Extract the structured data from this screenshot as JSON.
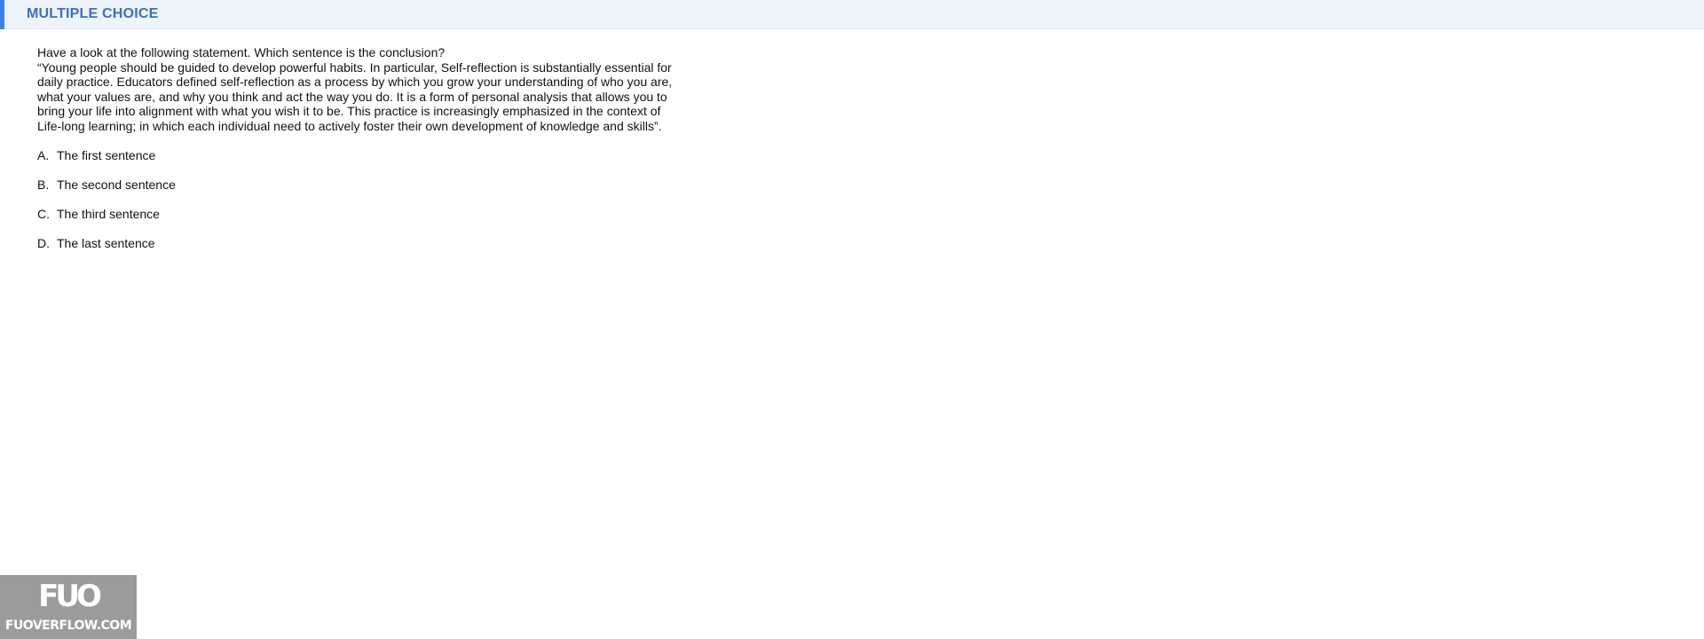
{
  "header": {
    "title": "MULTIPLE CHOICE",
    "accent_color": "#3b82e6",
    "background_color": "#eef4fc",
    "title_color": "#3a6fc4"
  },
  "question": {
    "prompt": "Have a look at the following statement. Which sentence is the conclusion?",
    "statement": "“Young people should be guided to develop powerful habits. In particular, Self-reflection is substantially essential for daily practice. Educators defined self-reflection as a process by which you grow your understanding of who you are, what your values are, and why you think and act the way you do. It is a form of personal analysis that allows you to bring your life into alignment with what you wish it to be. This practice is increasingly emphasized in the context of Life-long learning; in which each individual need to actively foster their own development of knowledge and skills”.",
    "options": [
      {
        "letter": "A.",
        "text": "The first sentence"
      },
      {
        "letter": "B.",
        "text": "The second sentence"
      },
      {
        "letter": "C.",
        "text": "The third sentence"
      },
      {
        "letter": "D.",
        "text": "The last sentence"
      }
    ]
  },
  "watermark": {
    "mark": "FUO",
    "text": "FUOVERFLOW.COM"
  }
}
